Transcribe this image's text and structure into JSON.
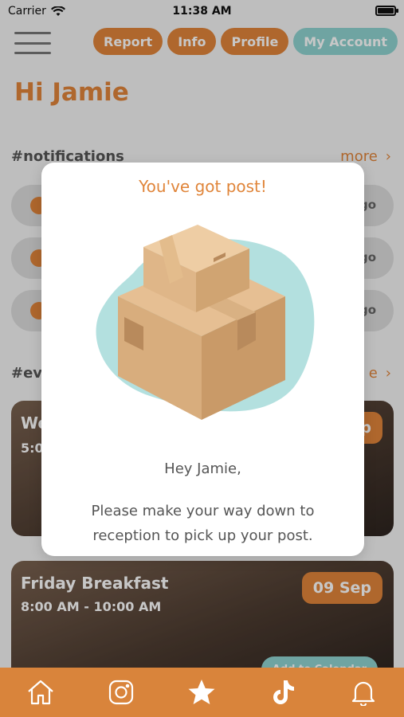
{
  "status_bar": {
    "carrier": "Carrier",
    "time": "11:38 AM"
  },
  "header": {
    "pills": [
      {
        "label": "Report"
      },
      {
        "label": "Info"
      },
      {
        "label": "Profile"
      },
      {
        "label": "My Account"
      }
    ]
  },
  "greeting": "Hi Jamie",
  "notifications": {
    "label": "#notifications",
    "more": "more",
    "items": [
      {
        "ago": "go"
      },
      {
        "ago": "go"
      },
      {
        "ago": "go"
      }
    ]
  },
  "events": {
    "label": "#ev",
    "more": "e",
    "cards": [
      {
        "title": "We",
        "time": "5:0",
        "date": "p"
      },
      {
        "title": "Friday Breakfast",
        "time": "8:00 AM - 10:00 AM",
        "date": "09 Sep",
        "calendar_button": "Add to Calendar"
      }
    ]
  },
  "modal": {
    "title": "You've got post!",
    "greeting": "Hey Jamie,",
    "body": "Please make your way down to reception to pick up your post."
  },
  "tabs": [
    {
      "icon": "home-icon"
    },
    {
      "icon": "instagram-icon"
    },
    {
      "icon": "star-icon"
    },
    {
      "icon": "tiktok-icon"
    },
    {
      "icon": "bell-icon"
    }
  ],
  "colors": {
    "accent": "#e0853a",
    "teal": "#8fd3d0",
    "tabbar": "#d9843b"
  }
}
